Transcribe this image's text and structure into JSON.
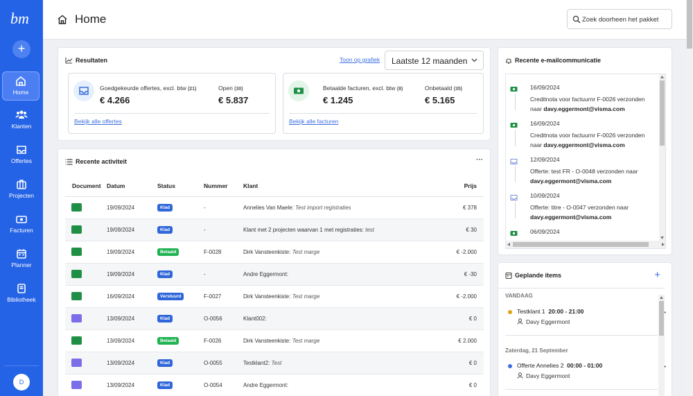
{
  "sidebar": {
    "logo_text": "bm",
    "add_label": "+",
    "items": [
      {
        "label": "Home",
        "icon": "home-icon"
      },
      {
        "label": "Klanten",
        "icon": "users-icon"
      },
      {
        "label": "Offertes",
        "icon": "inbox-icon"
      },
      {
        "label": "Projecten",
        "icon": "briefcase-icon"
      },
      {
        "label": "Facturen",
        "icon": "banknote-icon"
      },
      {
        "label": "Planner",
        "icon": "calendar-icon"
      },
      {
        "label": "Bibliotheek",
        "icon": "book-icon"
      }
    ],
    "avatar_initial": "D"
  },
  "header": {
    "title": "Home",
    "search_placeholder": "Zoek doorheen het pakket"
  },
  "results": {
    "title": "Resultaten",
    "graph_link": "Toon op grafiek",
    "period": "Laatste 12 maanden",
    "quotes": {
      "label": "Goedgekeurde offertes, excl. btw",
      "count": "(21)",
      "value": "€ 4.266",
      "open_label": "Open",
      "open_count": "(30)",
      "open_value": "€ 5.837",
      "link": "Bekijk alle offertes"
    },
    "invoices": {
      "label": "Betaalde facturen, excl. btw",
      "count": "(8)",
      "value": "€ 1.245",
      "unpaid_label": "Onbetaald",
      "unpaid_count": "(35)",
      "unpaid_value": "€ 5.165",
      "link": "Bekijk alle facturen"
    }
  },
  "activity": {
    "title": "Recente activiteit",
    "more": "···",
    "columns": [
      "Document",
      "Datum",
      "Status",
      "Nummer",
      "Klant",
      "Prijs"
    ],
    "rows": [
      {
        "doc": "invoice",
        "date": "19/09/2024",
        "status": "Klad",
        "status_color": "#2f66d9",
        "number": "-",
        "client": "Annelies Van Maele:",
        "note": "Test import registraties",
        "price": "€ 378"
      },
      {
        "doc": "invoice",
        "date": "19/09/2024",
        "status": "Klad",
        "status_color": "#2f66d9",
        "number": "-",
        "client": "Klant met 2 projecten waarvan 1 met registraties:",
        "note": "test",
        "price": "€ 30"
      },
      {
        "doc": "invoice",
        "date": "19/09/2024",
        "status": "Betaald",
        "status_color": "#20b253",
        "number": "F-0028",
        "client": "Dirk Vansteenkiste:",
        "note": "Test marge",
        "price": "€ -2.000"
      },
      {
        "doc": "invoice",
        "date": "19/09/2024",
        "status": "Klad",
        "status_color": "#2f66d9",
        "number": "-",
        "client": "Andre Eggermont:",
        "note": "",
        "price": "€ -30"
      },
      {
        "doc": "invoice",
        "date": "16/09/2024",
        "status": "Verstuurd",
        "status_color": "#2f66d9",
        "number": "F-0027",
        "client": "Dirk Vansteenkiste:",
        "note": "Test marge",
        "price": "€ -2.000"
      },
      {
        "doc": "quote",
        "date": "13/09/2024",
        "status": "Klad",
        "status_color": "#2f66d9",
        "number": "O-0056",
        "client": "Klant002:",
        "note": "",
        "price": "€ 0"
      },
      {
        "doc": "invoice",
        "date": "13/09/2024",
        "status": "Betaald",
        "status_color": "#20b253",
        "number": "F-0026",
        "client": "Dirk Vansteenkiste:",
        "note": "Test marge",
        "price": "€ 2.000"
      },
      {
        "doc": "quote",
        "date": "13/09/2024",
        "status": "Klad",
        "status_color": "#2f66d9",
        "number": "O-0055",
        "client": "Testklant2:",
        "note": "Test",
        "price": "€ 0"
      },
      {
        "doc": "quote",
        "date": "13/09/2024",
        "status": "Klad",
        "status_color": "#2f66d9",
        "number": "O-0054",
        "client": "Andre Eggermont:",
        "note": "",
        "price": "€ 0"
      }
    ]
  },
  "emails": {
    "title": "Recente e-mailcommunicatie",
    "items": [
      {
        "icon": "banknote-icon",
        "date": "16/09/2024",
        "text": "Creditnota voor factuurnr F-0026 verzonden naar",
        "email": "davy.eggermont@visma.com"
      },
      {
        "icon": "banknote-icon",
        "date": "16/09/2024",
        "text": "Creditnota voor factuurnr F-0026 verzonden naar",
        "email": "davy.eggermont@visma.com"
      },
      {
        "icon": "inbox-icon",
        "date": "12/09/2024",
        "text": "Offerte: test FR - O-0048 verzonden naar",
        "email": "davy.eggermont@visma.com"
      },
      {
        "icon": "inbox-icon",
        "date": "10/09/2024",
        "text": "Offerte: titre - O-0047 verzonden naar",
        "email": "davy.eggermont@visma.com"
      },
      {
        "icon": "banknote-icon",
        "date": "06/09/2024",
        "text": "",
        "email": ""
      }
    ]
  },
  "planned": {
    "title": "Geplande items",
    "add": "+",
    "groups": [
      {
        "label": "VANDAAG",
        "items": [
          {
            "title": "Testklant 1",
            "time": "20:00 - 21:00",
            "user": "Davy Eggermont",
            "color": "#d9a514"
          }
        ]
      },
      {
        "label": "Zaterdag, 21 September",
        "items": [
          {
            "title": "Offerte Annelies 2",
            "time": "00:00 - 01:00",
            "user": "Davy Eggermont",
            "color": "#3a6fe0"
          }
        ]
      }
    ]
  },
  "colors": {
    "brand": "#2563e6",
    "invoice_icon": "#1f8f46",
    "quote_icon": "#7b6ee8",
    "link": "#3d6ee0"
  }
}
